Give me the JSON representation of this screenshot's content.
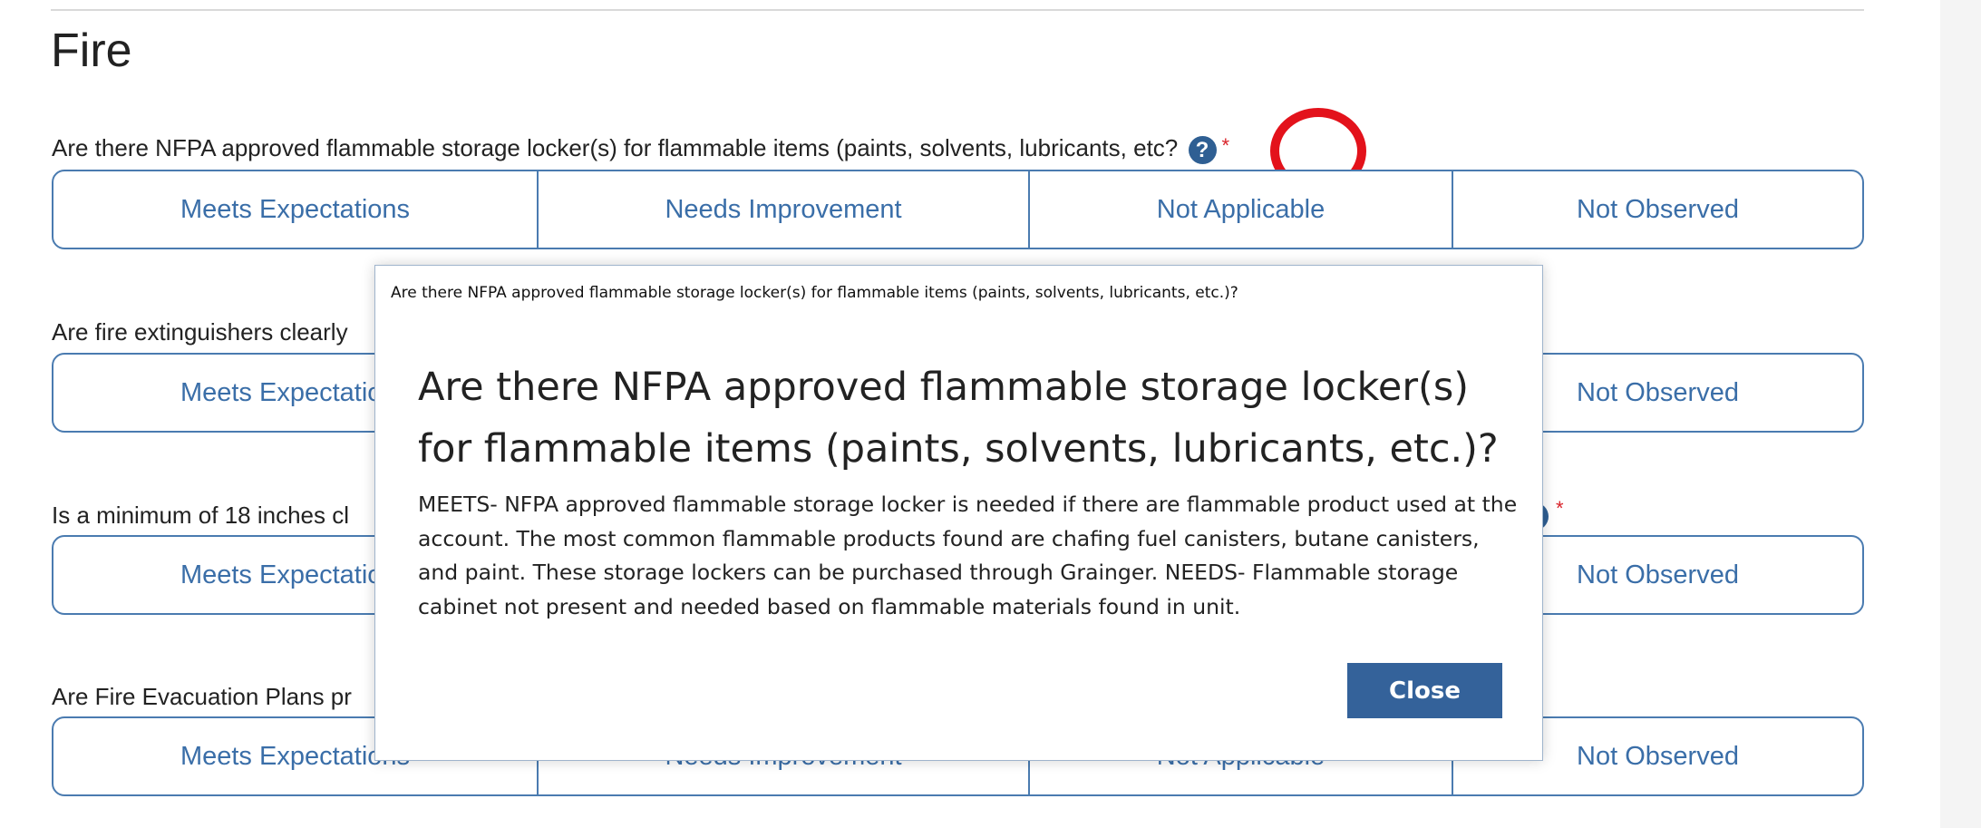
{
  "section": {
    "title": "Fire"
  },
  "options": [
    "Meets Expectations",
    "Needs Improvement",
    "Not Applicable",
    "Not Observed"
  ],
  "questions": [
    {
      "label": "Are there NFPA approved flammable storage locker(s) for flammable items (paints, solvents, lubricants, etc",
      "label_tail": "?",
      "help_icon": "?",
      "required_mark": "*"
    },
    {
      "label": "Are fire extinguishers clearly"
    },
    {
      "label": "Is a minimum of 18 inches cl",
      "required_mark": "*"
    },
    {
      "label": "Are Fire Evacuation Plans pr"
    }
  ],
  "modal": {
    "caption": "Are there NFPA approved flammable storage locker(s) for flammable items (paints, solvents, lubricants, etc.)?",
    "heading": "Are there NFPA approved flammable storage locker(s) for flammable items (paints, solvents, lubricants, etc.)?",
    "body": "MEETS- NFPA approved flammable storage locker is needed if there are flammable product used at the account. The most common flammable products found are chafing fuel canisters, butane canisters, and paint. These storage lockers can be purchased through Grainger. NEEDS- Flammable storage cabinet not present and needed based on flammable materials found in unit.",
    "close_label": "Close"
  },
  "colors": {
    "accent": "#3a6ea8",
    "highlight": "#e3121b",
    "required": "#d9232a",
    "close_button": "#34629a"
  }
}
